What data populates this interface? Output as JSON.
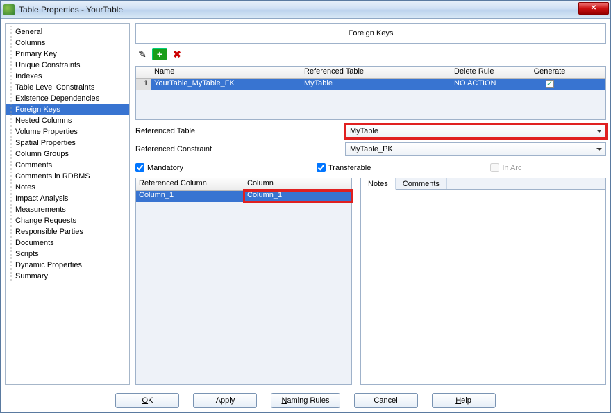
{
  "window": {
    "title": "Table Properties - YourTable"
  },
  "nav": {
    "items": [
      "General",
      "Columns",
      "Primary Key",
      "Unique Constraints",
      "Indexes",
      "Table Level Constraints",
      "Existence Dependencies",
      "Foreign Keys",
      "Nested Columns",
      "Volume Properties",
      "Spatial Properties",
      "Column Groups",
      "Comments",
      "Comments in RDBMS",
      "Notes",
      "Impact Analysis",
      "Measurements",
      "Change Requests",
      "Responsible Parties",
      "Documents",
      "Scripts",
      "Dynamic Properties",
      "Summary"
    ],
    "selected_index": 7
  },
  "content": {
    "header": "Foreign Keys",
    "fk_table": {
      "headers": {
        "name": "Name",
        "referenced": "Referenced Table",
        "delete_rule": "Delete Rule",
        "generate": "Generate"
      },
      "rows": [
        {
          "idx": "1",
          "name": "YourTable_MyTable_FK",
          "referenced": "MyTable",
          "delete_rule": "NO ACTION",
          "generate": true
        }
      ]
    },
    "labels": {
      "referenced_table": "Referenced Table",
      "referenced_constraint": "Referenced Constraint",
      "mandatory": "Mandatory",
      "transferable": "Transferable",
      "in_arc": "In Arc"
    },
    "referenced_table_value": "MyTable",
    "referenced_constraint_value": "MyTable_PK",
    "mandatory_checked": true,
    "transferable_checked": true,
    "in_arc_checked": false,
    "cols_table": {
      "headers": {
        "referenced_column": "Referenced Column",
        "column": "Column"
      },
      "rows": [
        {
          "referenced": "Column_1",
          "column": "Column_1"
        }
      ]
    },
    "tabs": {
      "notes": "Notes",
      "comments": "Comments"
    }
  },
  "buttons": {
    "ok": "OK",
    "apply": "Apply",
    "naming": "Naming Rules",
    "cancel": "Cancel",
    "help": "Help"
  }
}
